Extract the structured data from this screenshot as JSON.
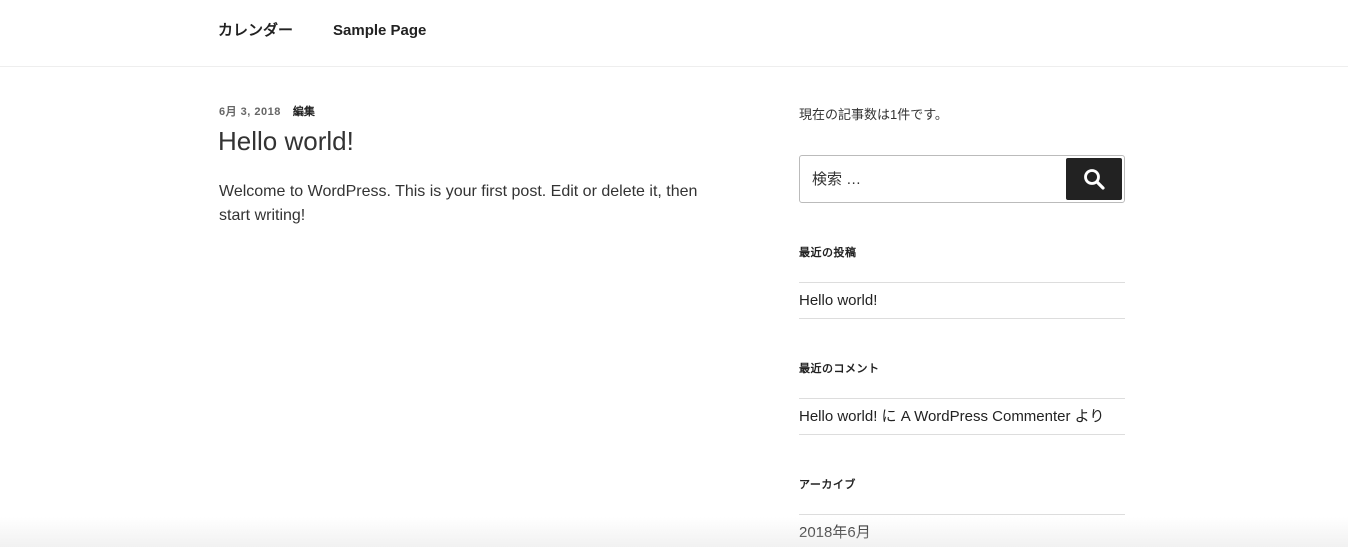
{
  "nav": {
    "items": [
      {
        "label": "カレンダー"
      },
      {
        "label": "Sample Page"
      }
    ]
  },
  "post": {
    "date": "6月 3, 2018",
    "edit_label": "編集",
    "title": "Hello world!",
    "content": "Welcome to WordPress. This is your first post. Edit or delete it, then start writing!"
  },
  "sidebar": {
    "post_count_text": "現在の記事数は1件です。",
    "search": {
      "placeholder": "検索 …",
      "icon": "search-icon"
    },
    "recent_posts": {
      "title": "最近の投稿",
      "items": [
        "Hello world!"
      ]
    },
    "recent_comments": {
      "title": "最近のコメント",
      "items": [
        {
          "post": "Hello world!",
          "joiner": " に ",
          "author": "A WordPress Commenter",
          "suffix": " より"
        }
      ]
    },
    "archives": {
      "title": "アーカイブ",
      "items": [
        "2018年6月"
      ]
    }
  },
  "colors": {
    "text": "#222222",
    "meta": "#666666",
    "border": "#dddddd",
    "search_button": "#222222"
  }
}
